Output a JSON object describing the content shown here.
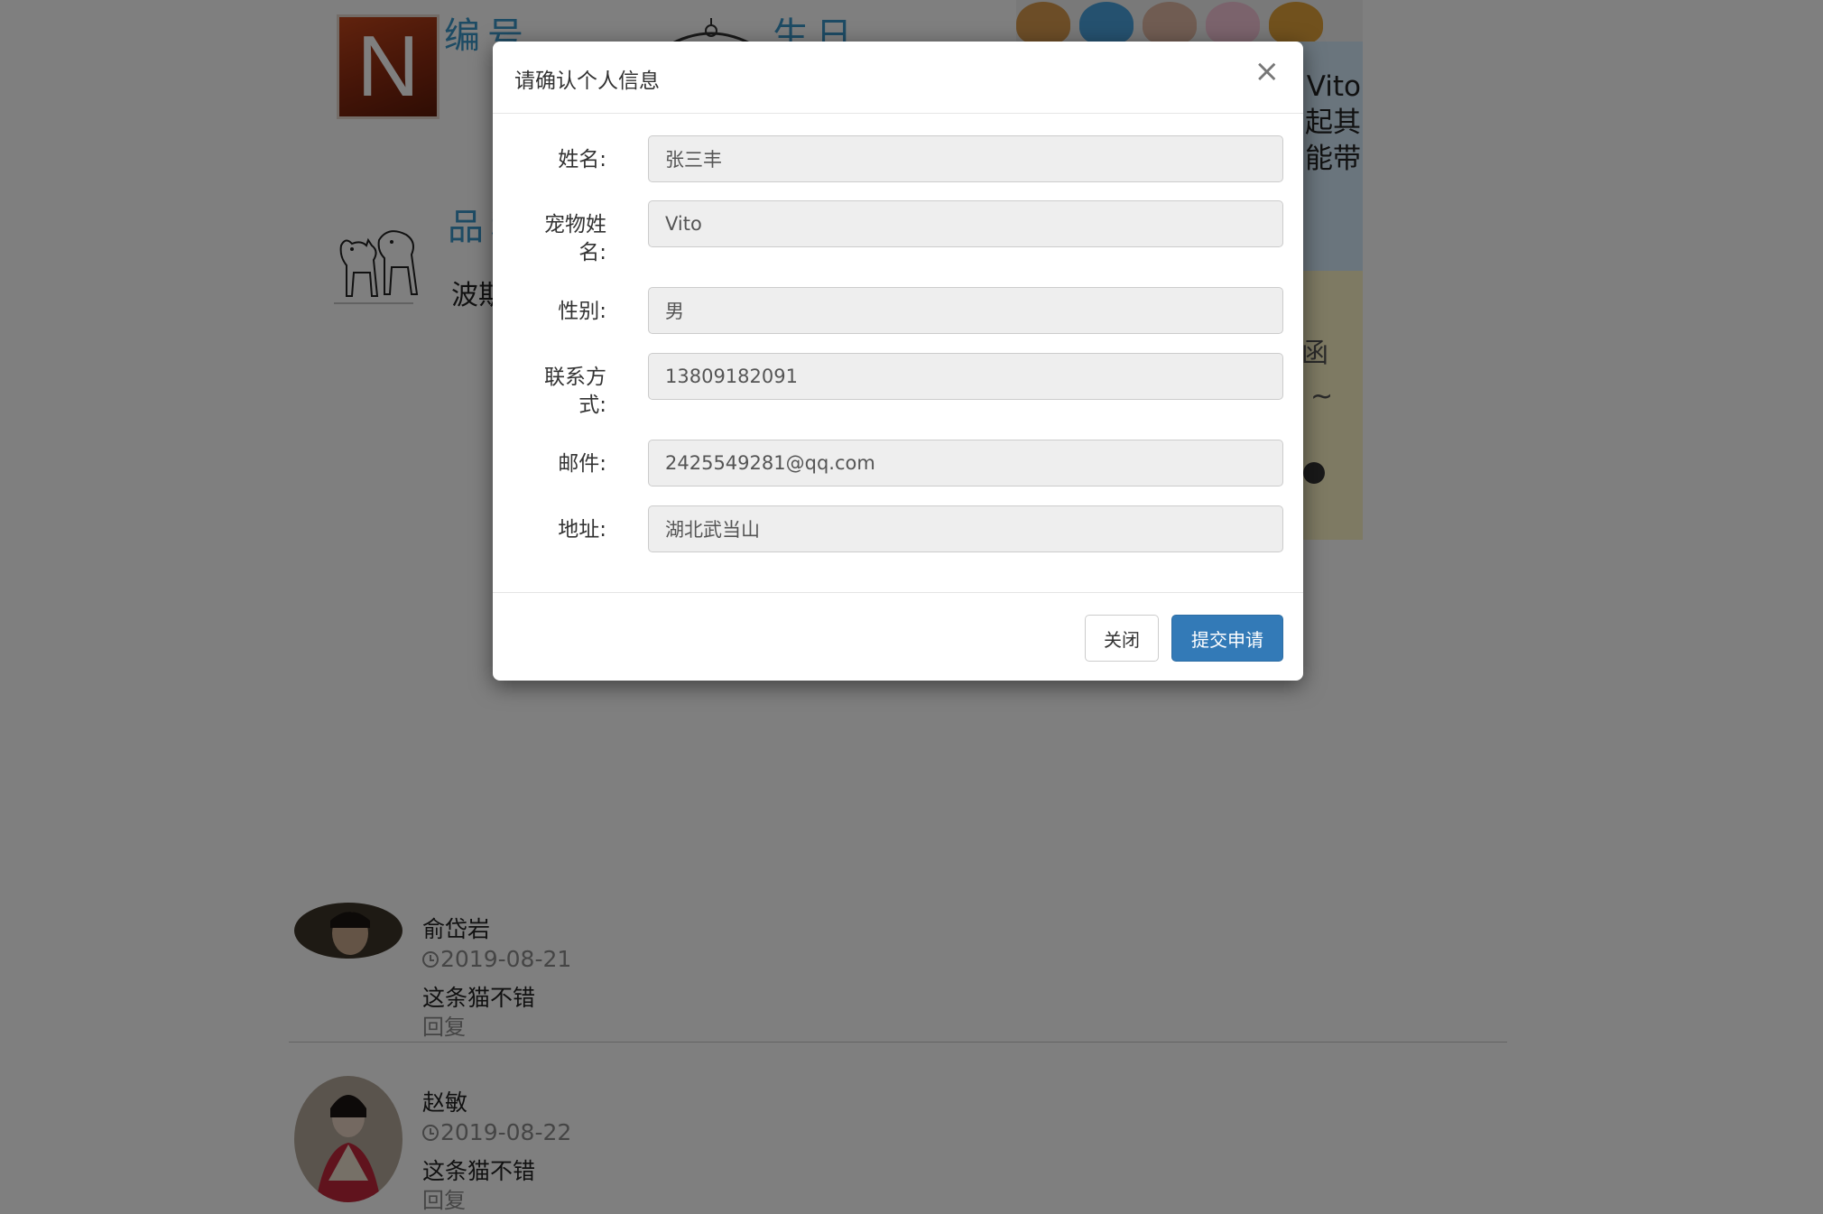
{
  "background": {
    "logo_letter": "N",
    "heading_number": "编号",
    "heading_birthday": "生日",
    "heading_breed": "品种",
    "breed_value": "波斯",
    "side_blue_lines": [
      "Vito",
      "起其",
      "能带"
    ],
    "side_yellow_marks": [
      "函",
      "~"
    ]
  },
  "modal": {
    "title": "请确认个人信息",
    "close_symbol": "×",
    "fields": [
      {
        "label": "姓名:",
        "value": "张三丰"
      },
      {
        "label": "宠物姓名:",
        "value": "Vito"
      },
      {
        "label": "性别:",
        "value": "男"
      },
      {
        "label": "联系方式:",
        "value": "13809182091"
      },
      {
        "label": "邮件:",
        "value": "2425549281@qq.com"
      },
      {
        "label": "地址:",
        "value": "湖北武当山"
      }
    ],
    "close_button": "关闭",
    "submit_button": "提交申请"
  },
  "comments": [
    {
      "author": "俞岱岩",
      "date": "2019-08-21",
      "text": "这条猫不错",
      "reply": "回复"
    },
    {
      "author": "赵敏",
      "date": "2019-08-22",
      "text": "这条猫不错",
      "reply": "回复"
    }
  ],
  "icons": {
    "close": "close-icon",
    "clock": "clock-icon"
  },
  "colors": {
    "primary": "#337ab7",
    "heading_blue": "#3b97c9",
    "backdrop": "rgba(0,0,0,0.5)"
  }
}
